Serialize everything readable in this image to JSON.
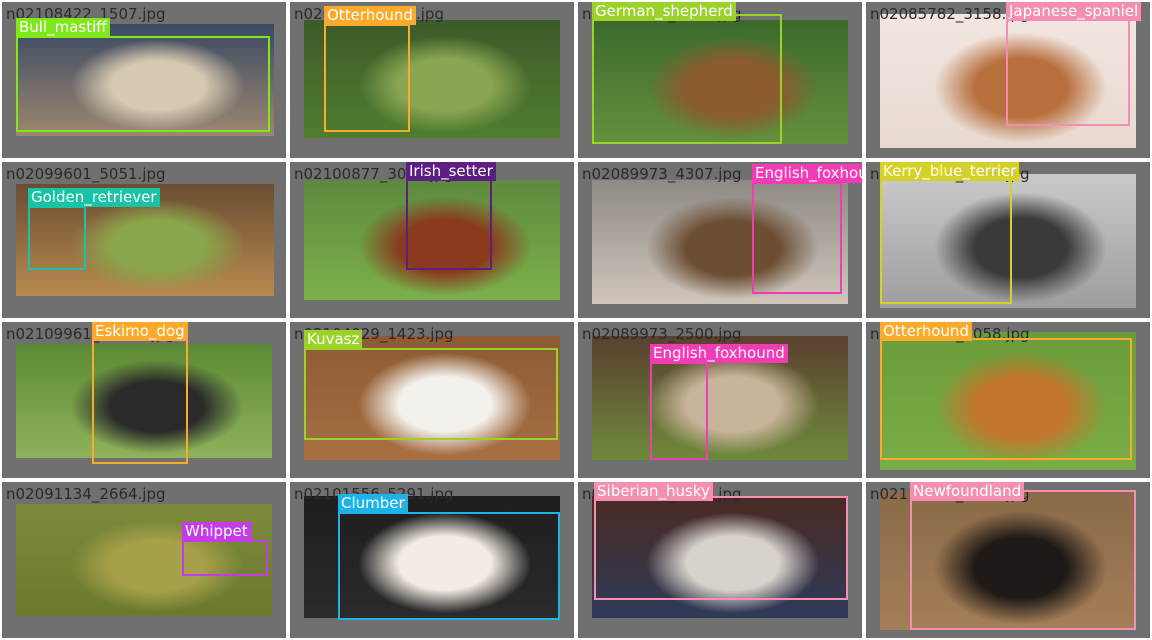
{
  "items": [
    {
      "filename": "n02108422_1507.jpg",
      "label": "Bull_mastiff",
      "color": "#7FE81A",
      "bg": [
        "#3a4a63",
        "#d6c9b2",
        "#9d8770"
      ]
    },
    {
      "filename": "n02091635_971.jpg",
      "label": "Otterhound",
      "color": "#FBAA2B",
      "bg": [
        "#3d5a2a",
        "#8aa653",
        "#4f7e2e"
      ]
    },
    {
      "filename": "n02106662_4059.jpg",
      "label": "German_shepherd",
      "color": "#9BD12B",
      "bg": [
        "#3b6a2c",
        "#8c5b2e",
        "#64913d"
      ]
    },
    {
      "filename": "n02085782_3158.jpg",
      "label": "Japanese_spaniel",
      "color": "#F48FB1",
      "bg": [
        "#f2e6e1",
        "#b86f3e",
        "#e7d9cf"
      ]
    },
    {
      "filename": "n02099601_5051.jpg",
      "label": "Golden_retriever",
      "color": "#19C4A6",
      "bg": [
        "#6a4d33",
        "#8aa64a",
        "#b88a4f"
      ]
    },
    {
      "filename": "n02100877_3091.jpg",
      "label": "Irish_setter",
      "color": "#5B1F83",
      "bg": [
        "#5e8a3d",
        "#8a3b1e",
        "#7bb04a"
      ]
    },
    {
      "filename": "n02089973_4307.jpg",
      "label": "English_foxhound",
      "color": "#F23CB5",
      "bg": [
        "#8e8a84",
        "#6b4e33",
        "#cfc6bb"
      ]
    },
    {
      "filename": "n02093859_2558.jpg",
      "label": "Kerry_blue_terrier",
      "color": "#D6D02A",
      "bg": [
        "#c9c9c9",
        "#3a3a3a",
        "#9e9e9e"
      ]
    },
    {
      "filename": "n02109961_11345.jpg",
      "label": "Eskimo_dog",
      "color": "#FBAA2B",
      "bg": [
        "#5c8a34",
        "#2a2a2a",
        "#8fb25c"
      ]
    },
    {
      "filename": "n02104029_1423.jpg",
      "label": "Kuvasz",
      "color": "#9BD12B",
      "bg": [
        "#8c5b33",
        "#f4f1ec",
        "#a86f43"
      ]
    },
    {
      "filename": "n02089973_2500.jpg",
      "label": "English_foxhound",
      "color": "#F23CB5",
      "bg": [
        "#5a4030",
        "#c8b49a",
        "#6e8a3a"
      ]
    },
    {
      "filename": "n02091635_4058.jpg",
      "label": "Otterhound",
      "color": "#FBAA2B",
      "bg": [
        "#6a9c3b",
        "#c2772c",
        "#7aad45"
      ]
    },
    {
      "filename": "n02091134_2664.jpg",
      "label": "Whippet",
      "color": "#C43CE8",
      "bg": [
        "#7d8a3a",
        "#a7a04a",
        "#6a7a2e"
      ]
    },
    {
      "filename": "n02101556_5291.jpg",
      "label": "Clumber",
      "color": "#1EB2E6",
      "bg": [
        "#1e1e1e",
        "#f3ece3",
        "#2a2a2a"
      ]
    },
    {
      "filename": "n02110185_1294.jpg",
      "label": "Siberian_husky",
      "color": "#F48FB1",
      "bg": [
        "#4a2a22",
        "#d8d2cc",
        "#2e3a58"
      ]
    },
    {
      "filename": "n02111277_4881.jpg",
      "label": "Newfoundland",
      "color": "#F48FB1",
      "bg": [
        "#8a6a48",
        "#1f1a17",
        "#a47e58"
      ]
    }
  ]
}
